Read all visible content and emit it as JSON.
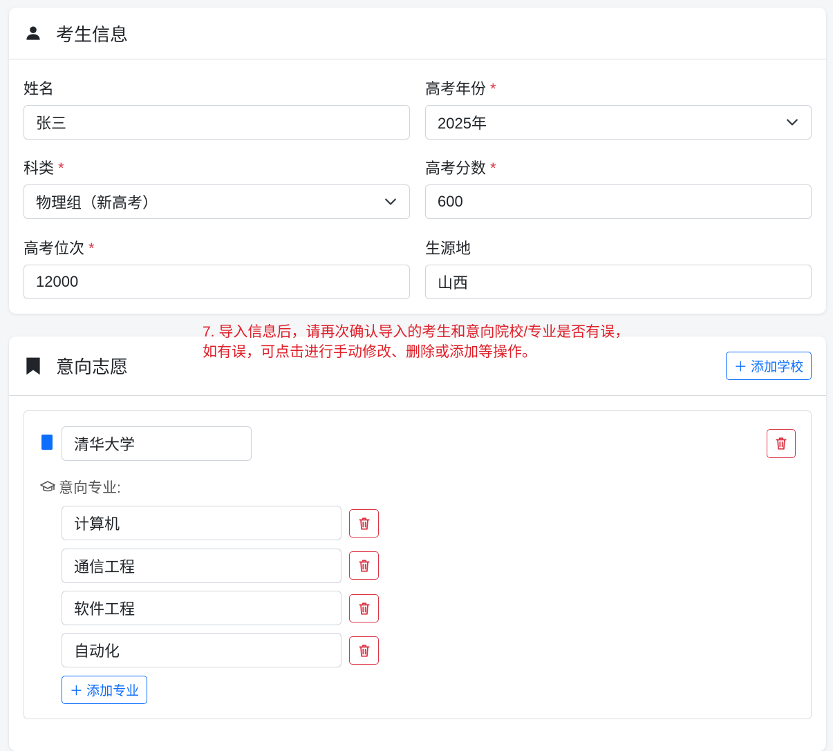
{
  "student_card": {
    "title": "考生信息",
    "icon": "person-icon",
    "fields": {
      "name": {
        "label": "姓名",
        "value": "张三"
      },
      "year": {
        "label": "高考年份",
        "value": "2025年",
        "required_mark": "*"
      },
      "category": {
        "label": "科类",
        "value": "物理组（新高考）",
        "required_mark": "*"
      },
      "score": {
        "label": "高考分数",
        "value": "600",
        "required_mark": "*"
      },
      "rank": {
        "label": "高考位次",
        "value": "12000",
        "required_mark": "*"
      },
      "origin": {
        "label": "生源地",
        "value": "山西"
      }
    }
  },
  "annotation": {
    "line1": "7. 导入信息后，请再次确认导入的考生和意向院校/专业是否有误，",
    "line2": "如有误，可点击进行手动修改、删除或添加等操作。"
  },
  "wish_card": {
    "title": "意向志愿",
    "icon": "bookmark-icon",
    "add_school_label": "＋ 添加学校",
    "school": {
      "name": "清华大学",
      "majors_label": "意向专业:",
      "majors": [
        "计算机",
        "通信工程",
        "软件工程",
        "自动化"
      ],
      "add_major_label": "＋ 添加专业"
    }
  },
  "colors": {
    "primary": "#0d6efd",
    "danger": "#dc3545",
    "annotation": "#e0202a"
  }
}
